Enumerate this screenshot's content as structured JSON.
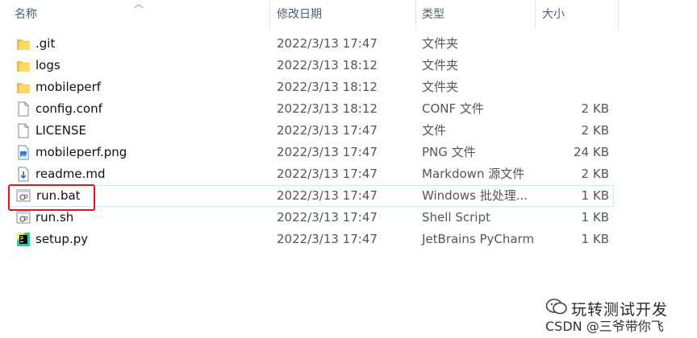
{
  "columns": {
    "name": "名称",
    "modified": "修改日期",
    "type": "类型",
    "size": "大小"
  },
  "files": [
    {
      "name": ".git",
      "modified": "2022/3/13 17:47",
      "type": "文件夹",
      "size": "",
      "icon": "folder-icon"
    },
    {
      "name": "logs",
      "modified": "2022/3/13 18:12",
      "type": "文件夹",
      "size": "",
      "icon": "folder-icon"
    },
    {
      "name": "mobileperf",
      "modified": "2022/3/13 18:12",
      "type": "文件夹",
      "size": "",
      "icon": "folder-icon"
    },
    {
      "name": "config.conf",
      "modified": "2022/3/13 18:12",
      "type": "CONF 文件",
      "size": "2 KB",
      "icon": "file-icon"
    },
    {
      "name": "LICENSE",
      "modified": "2022/3/13 17:47",
      "type": "文件",
      "size": "2 KB",
      "icon": "file-icon"
    },
    {
      "name": "mobileperf.png",
      "modified": "2022/3/13 17:47",
      "type": "PNG 文件",
      "size": "24 KB",
      "icon": "image-file-icon"
    },
    {
      "name": "readme.md",
      "modified": "2022/3/13 17:47",
      "type": "Markdown 源文件",
      "size": "2 KB",
      "icon": "markdown-file-icon"
    },
    {
      "name": "run.bat",
      "modified": "2022/3/13 17:47",
      "type": "Windows 批处理...",
      "size": "1 KB",
      "icon": "batch-file-icon"
    },
    {
      "name": "run.sh",
      "modified": "2022/3/13 17:47",
      "type": "Shell Script",
      "size": "1 KB",
      "icon": "batch-file-icon"
    },
    {
      "name": "setup.py",
      "modified": "2022/3/13 17:47",
      "type": "JetBrains PyCharm",
      "size": "1 KB",
      "icon": "pycharm-file-icon"
    }
  ],
  "watermark": {
    "channel": "玩转测试开发",
    "credit": "CSDN @三爷带你飞"
  },
  "colors": {
    "highlight_border": "#cde8ff",
    "annotation_red": "#e0141a",
    "folder_yellow": "#f8c840"
  }
}
